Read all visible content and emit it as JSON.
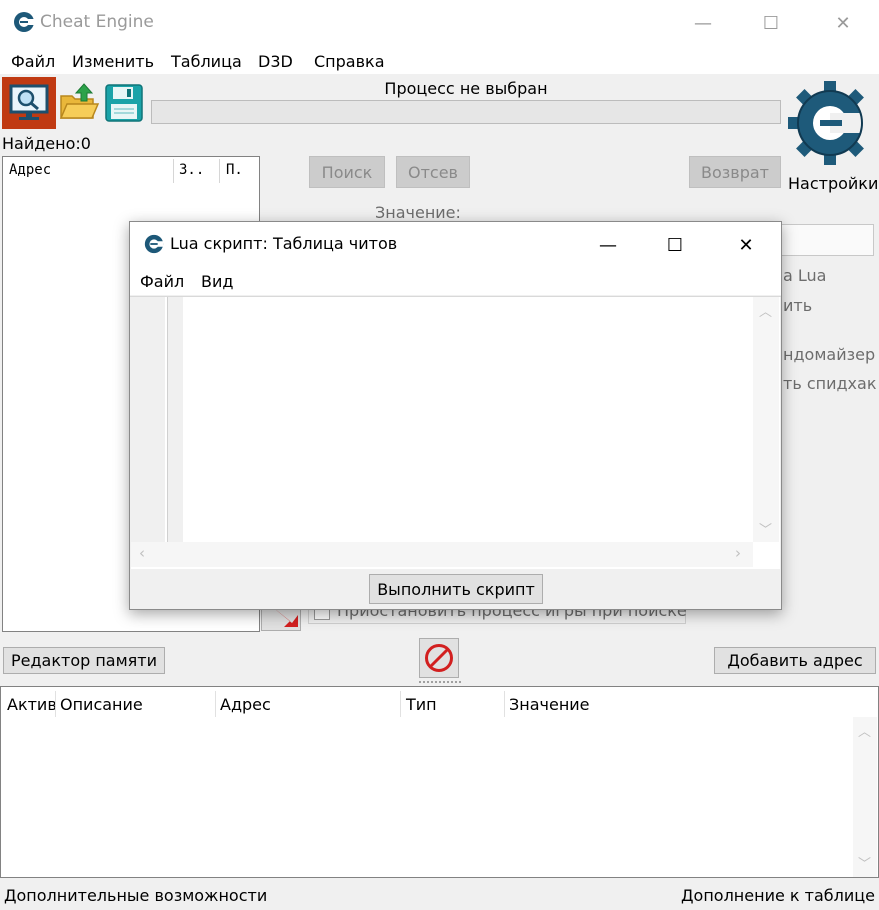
{
  "window": {
    "title": "Cheat Engine",
    "min_glyph": "—",
    "max_glyph": "☐",
    "close_glyph": "✕"
  },
  "menu": [
    "Файл",
    "Изменить",
    "Таблица",
    "D3D",
    "Справка"
  ],
  "process_label": "Процесс не выбран",
  "found_label": "Найдено:0",
  "settings_label": "Настройки",
  "scan_results": {
    "columns": [
      "Адрес",
      "З..",
      "П."
    ]
  },
  "scan_buttons": {
    "first_scan": "Поиск",
    "next_scan": "Отсев",
    "undo_scan": "Возврат"
  },
  "value_label": "Значение:",
  "hidden_options": {
    "lua_fragment": "a Lua",
    "fragment2": "ить",
    "randomizer_fragment": "ндомайзер",
    "speedhack_fragment": "ть спидхак",
    "pause_checkbox": "Приостановить процесс игры при поиске"
  },
  "memory_view_button": "Редактор памяти",
  "add_address_button": "Добавить адрес",
  "address_table": {
    "columns": [
      "Актив",
      "Описание",
      "Адрес",
      "Тип",
      "Значение"
    ]
  },
  "footer": {
    "left": "Дополнительные возможности",
    "right": "Дополнение к таблице"
  },
  "lua_dialog": {
    "title": "Lua скрипт: Таблица читов",
    "menu": [
      "Файл",
      "Вид"
    ],
    "execute_button": "Выполнить скрипт",
    "min_glyph": "—",
    "max_glyph": "☐",
    "close_glyph": "✕"
  },
  "colors": {
    "accent_red": "#c03a12",
    "logo_blue": "#1e5a7a"
  }
}
